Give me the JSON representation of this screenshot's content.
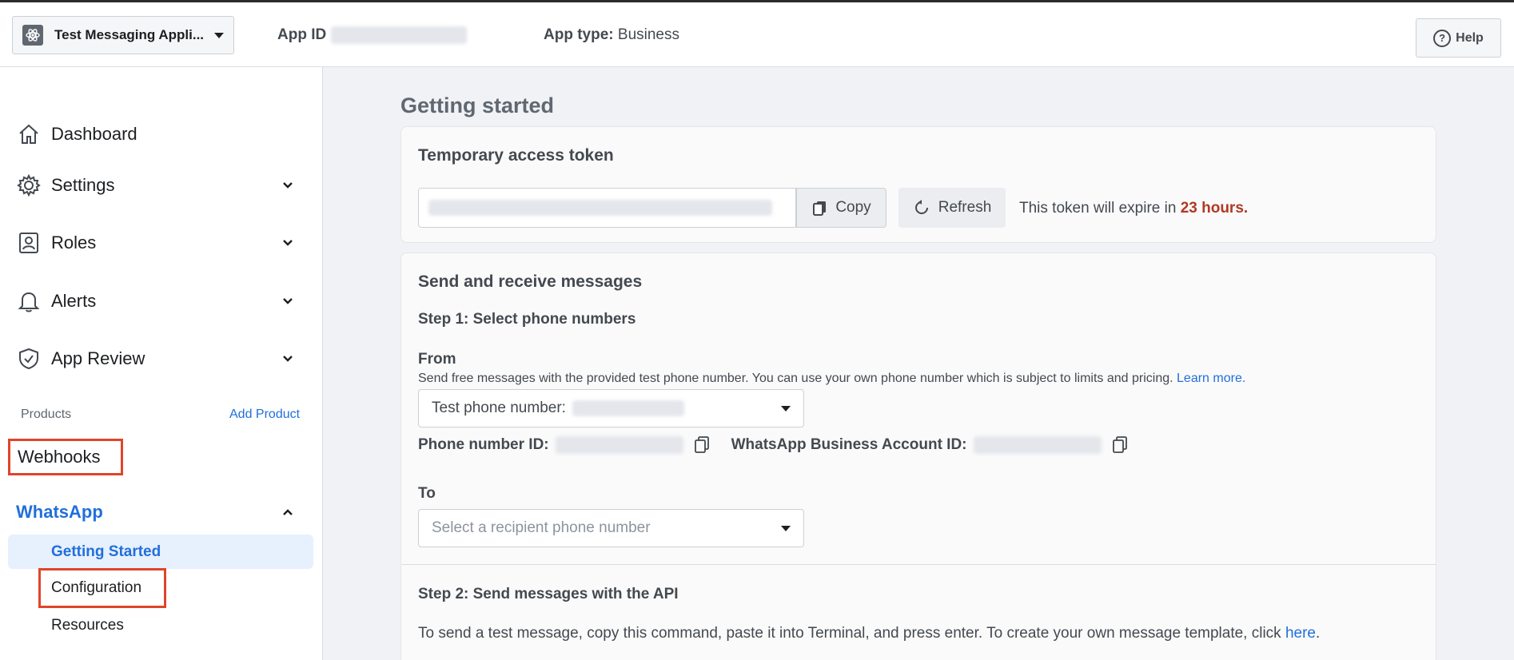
{
  "header": {
    "app_name": "Test Messaging Appli...",
    "app_id_label": "App ID",
    "app_type_label": "App type:",
    "app_type_value": "Business",
    "help_label": "Help"
  },
  "sidebar": {
    "items": [
      {
        "label": "Dashboard",
        "icon": "home-icon"
      },
      {
        "label": "Settings",
        "icon": "gear-icon"
      },
      {
        "label": "Roles",
        "icon": "roles-icon"
      },
      {
        "label": "Alerts",
        "icon": "bell-icon"
      },
      {
        "label": "App Review",
        "icon": "shield-check-icon"
      }
    ],
    "products_label": "Products",
    "add_product": "Add Product",
    "webhooks": "Webhooks",
    "whatsapp": "WhatsApp",
    "sub_items": {
      "getting_started": "Getting Started",
      "configuration": "Configuration",
      "resources": "Resources"
    }
  },
  "main": {
    "title": "Getting started",
    "token_card": {
      "title": "Temporary access token",
      "copy": "Copy",
      "refresh": "Refresh",
      "expire_text": "This token will expire in",
      "expire_value": "23 hours."
    },
    "messages_card": {
      "title": "Send and receive messages",
      "step1": "Step 1: Select phone numbers",
      "from_label": "From",
      "from_desc": "Send free messages with the provided test phone number. You can use your own phone number which is subject to limits and pricing.",
      "learn_more": "Learn more.",
      "from_select": "Test phone number:",
      "phone_id_label": "Phone number ID:",
      "waba_id_label": "WhatsApp Business Account ID:",
      "to_label": "To",
      "to_placeholder": "Select a recipient phone number",
      "step2": "Step 2: Send messages with the API",
      "cmd_text": "To send a test message, copy this command, paste it into Terminal, and press enter. To create your own message template, click",
      "here": "here",
      "cmd_end": "."
    }
  }
}
